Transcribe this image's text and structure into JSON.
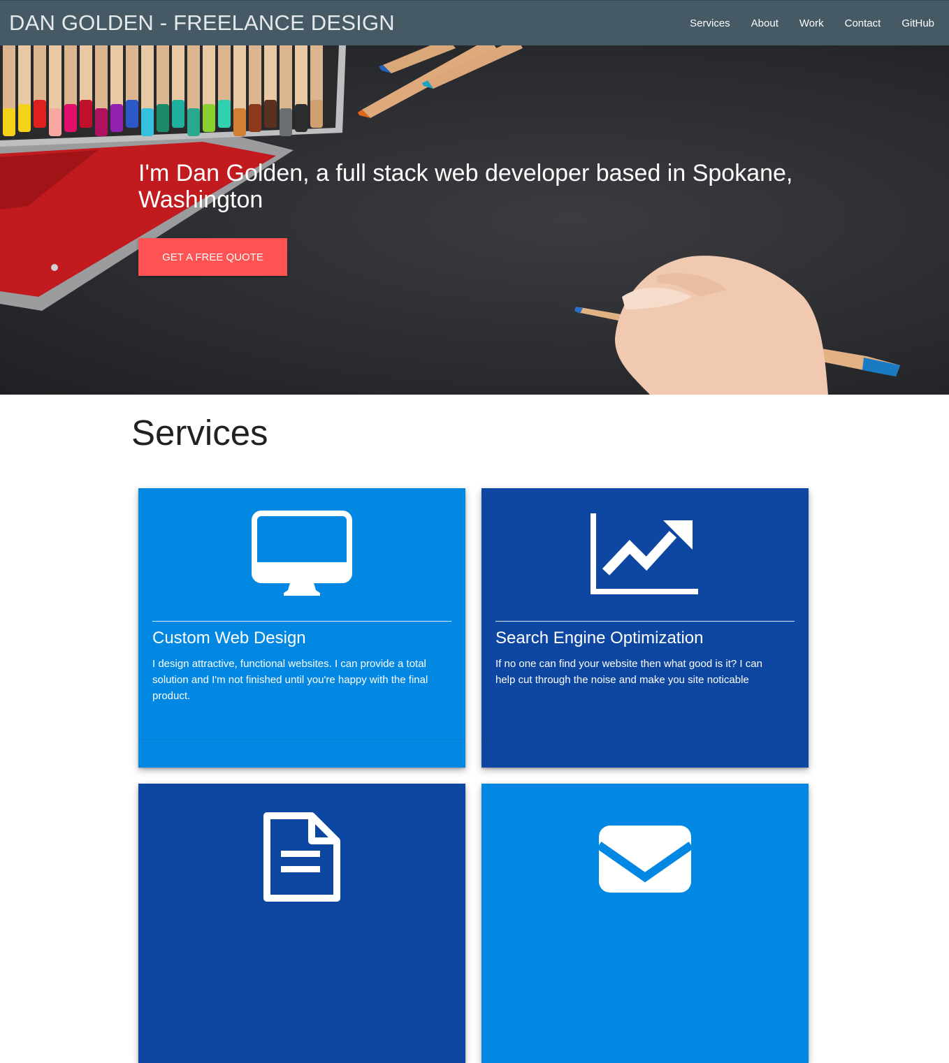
{
  "navbar": {
    "brand": "DAN GOLDEN - FREELANCE DESIGN",
    "links": [
      "Services",
      "About",
      "Work",
      "Contact",
      "GitHub"
    ]
  },
  "hero": {
    "headline": "I'm Dan Golden, a full stack web developer based in Spokane, Washington",
    "cta_label": "GET A FREE QUOTE"
  },
  "services": {
    "title": "Services",
    "cards": [
      {
        "title": "Custom Web Design",
        "text": "I design attractive, functional websites. I can provide a total solution and I'm not finished until you're happy with the final product.",
        "icon": "desktop-icon",
        "color": "#0288e3"
      },
      {
        "title": "Search Engine Optimization",
        "text": "If no one can find your website then what good is it? I can help cut through the noise and make you site noticable",
        "icon": "chart-line-icon",
        "color": "#0e47a1"
      },
      {
        "title": "",
        "text": "",
        "icon": "document-icon",
        "color": "#0e47a1"
      },
      {
        "title": "",
        "text": "",
        "icon": "envelope-icon",
        "color": "#0288e3"
      }
    ]
  },
  "colors": {
    "navbar": "#455a64",
    "cta": "#ff5252",
    "card_light": "#0288e3",
    "card_dark": "#0e47a1"
  }
}
